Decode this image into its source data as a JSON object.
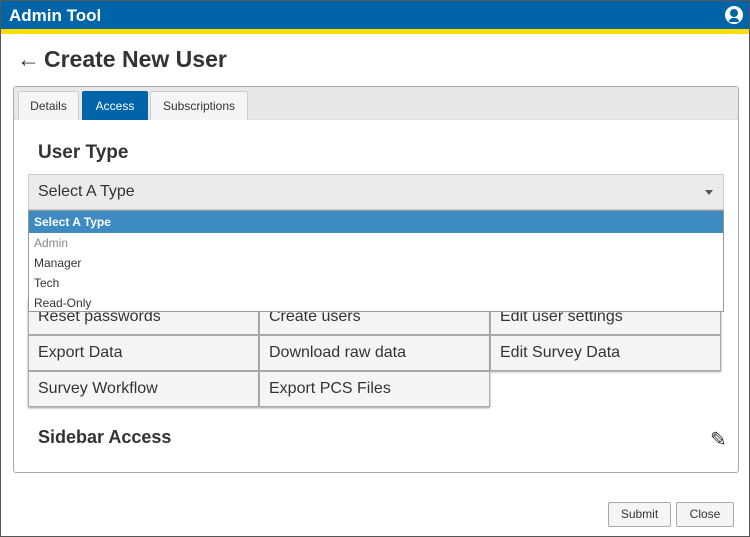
{
  "header": {
    "title": "Admin Tool",
    "user_icon": "user-circle-icon"
  },
  "page": {
    "title": "Create New User",
    "back_icon": "arrow-left-icon"
  },
  "tabs": [
    {
      "label": "Details"
    },
    {
      "label": "Access",
      "active": true
    },
    {
      "label": "Subscriptions"
    }
  ],
  "user_type": {
    "heading": "User Type",
    "selected": "Select A Type",
    "options": [
      "Select A Type",
      "Admin",
      "Manager",
      "Tech",
      "Read-Only"
    ]
  },
  "permissions": [
    "Reset passwords",
    "Create users",
    "Edit user settings",
    "Export Data",
    "Download raw data",
    "Edit Survey Data",
    "Survey Workflow",
    "Export PCS Files"
  ],
  "sidebar_access": {
    "heading": "Sidebar Access",
    "edit_icon": "pencil-icon"
  },
  "footer": {
    "submit": "Submit",
    "close": "Close"
  },
  "colors": {
    "brand": "#0064a8",
    "accent": "#ffdd00",
    "selected_option": "#3d8bc1"
  }
}
